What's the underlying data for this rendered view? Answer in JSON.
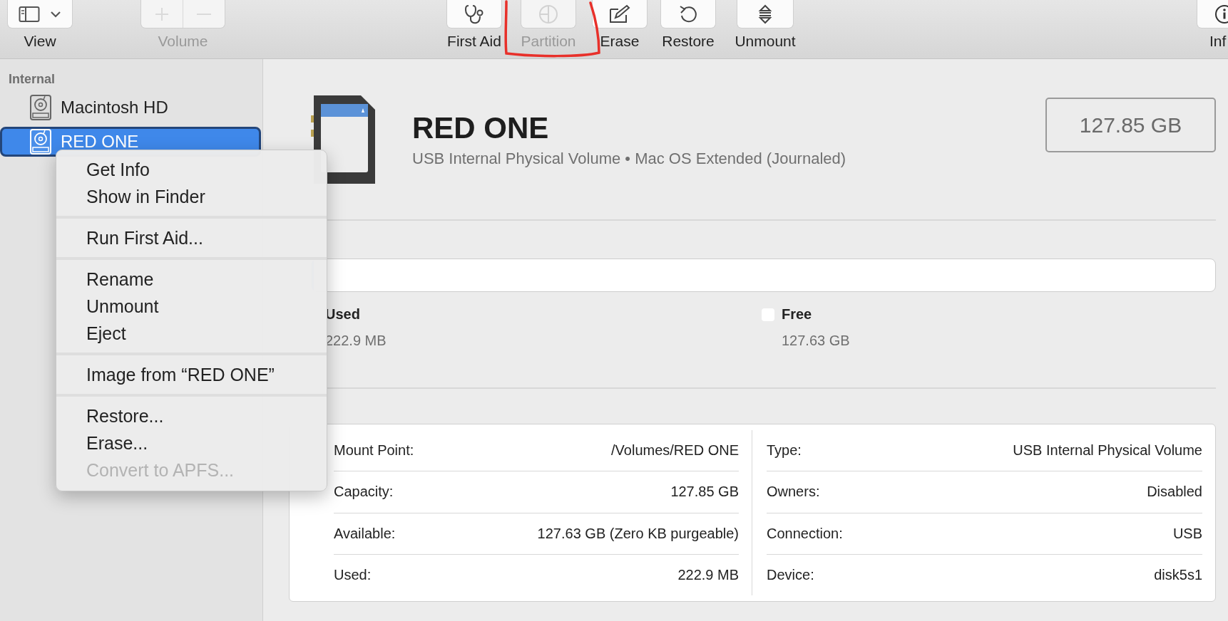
{
  "toolbar": {
    "buttons": [
      {
        "label": "View",
        "kind": "view",
        "disabled": false
      },
      {
        "label": "Volume",
        "kind": "volume",
        "disabled": true
      },
      {
        "label": "First Aid",
        "kind": "firstaid",
        "disabled": false
      },
      {
        "label": "Partition",
        "kind": "partition",
        "disabled": true
      },
      {
        "label": "Erase",
        "kind": "erase",
        "disabled": false
      },
      {
        "label": "Restore",
        "kind": "restore",
        "disabled": false
      },
      {
        "label": "Unmount",
        "kind": "unmount",
        "disabled": false
      },
      {
        "label": "Inf",
        "kind": "info",
        "disabled": false
      }
    ]
  },
  "sidebar": {
    "section": "Internal",
    "items": [
      {
        "label": "Macintosh HD",
        "selected": false
      },
      {
        "label": "RED ONE",
        "selected": true
      }
    ]
  },
  "volume": {
    "name": "RED ONE",
    "description": "USB Internal Physical Volume • Mac OS Extended (Journaled)",
    "size": "127.85 GB"
  },
  "usage": {
    "level": 0.002,
    "legend": [
      {
        "label": "Used",
        "value": "222.9 MB"
      },
      {
        "label": "Free",
        "value": "127.63 GB",
        "kind": "free"
      }
    ]
  },
  "info": {
    "left": [
      {
        "label": "Mount Point:",
        "value": "/Volumes/RED ONE"
      },
      {
        "label": "Capacity:",
        "value": "127.85 GB"
      },
      {
        "label": "Available:",
        "value": "127.63 GB (Zero KB purgeable)"
      },
      {
        "label": "Used:",
        "value": "222.9 MB"
      }
    ],
    "right": [
      {
        "label": "Type:",
        "value": "USB Internal Physical Volume"
      },
      {
        "label": "Owners:",
        "value": "Disabled"
      },
      {
        "label": "Connection:",
        "value": "USB"
      },
      {
        "label": "Device:",
        "value": "disk5s1"
      }
    ]
  },
  "context_menu": {
    "groups": [
      {
        "items": [
          {
            "label": "Get Info",
            "disabled": false
          },
          {
            "label": "Show in Finder",
            "disabled": false
          }
        ]
      },
      {
        "items": [
          {
            "label": "Run First Aid...",
            "disabled": false
          }
        ]
      },
      {
        "items": [
          {
            "label": "Rename",
            "disabled": false
          },
          {
            "label": "Unmount",
            "disabled": false
          },
          {
            "label": "Eject",
            "disabled": false
          }
        ]
      },
      {
        "items": [
          {
            "label": "Image from “RED ONE”",
            "disabled": false
          }
        ]
      },
      {
        "items": [
          {
            "label": "Restore...",
            "disabled": false
          },
          {
            "label": "Erase...",
            "disabled": false
          },
          {
            "label": "Convert to APFS...",
            "disabled": true
          }
        ]
      }
    ]
  }
}
